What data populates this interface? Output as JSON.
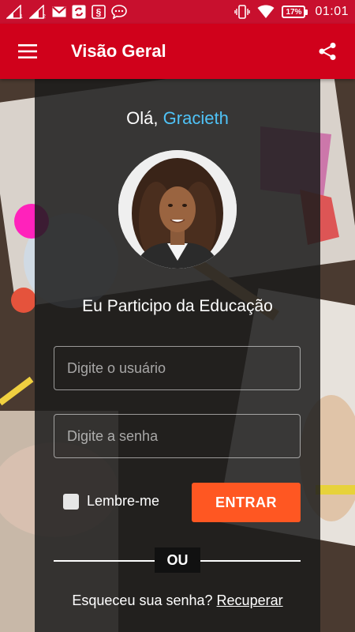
{
  "status_bar": {
    "time": "01:01",
    "battery": "17%",
    "icons": [
      "signal-1-icon",
      "signal-2-icon",
      "gmail-icon",
      "sync-icon",
      "dollar-app-icon",
      "chat-icon",
      "vibrate-icon",
      "wifi-icon",
      "battery-icon"
    ]
  },
  "app_bar": {
    "title": "Visão Geral",
    "menu_icon": "hamburger-menu-icon",
    "share_icon": "share-icon"
  },
  "greeting": {
    "prefix": "Olá,",
    "name": "Gracieth"
  },
  "subtitle": "Eu Participo da Educação",
  "form": {
    "username_placeholder": "Digite o usuário",
    "username_value": "",
    "password_placeholder": "Digite a senha",
    "password_value": "",
    "remember_label": "Lembre-me",
    "remember_checked": false,
    "submit_label": "ENTRAR"
  },
  "divider_label": "OU",
  "forgot": {
    "text": "Esqueceu sua senha?",
    "link": "Recuperar"
  },
  "colors": {
    "status_bar": "#c8102e",
    "app_bar": "#d0011b",
    "accent_name": "#4fc3f7",
    "submit_button": "#ff5722"
  }
}
